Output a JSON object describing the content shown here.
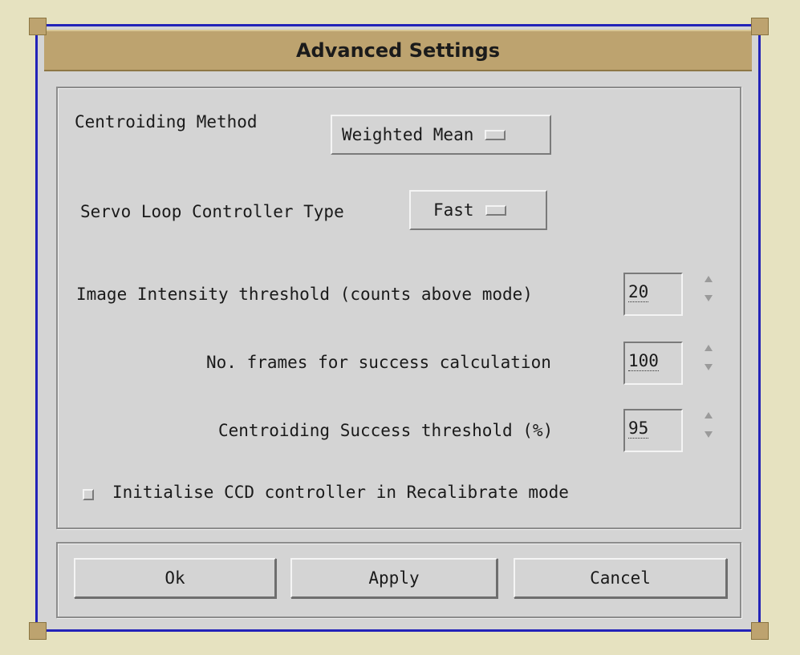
{
  "window": {
    "title": "Advanced Settings"
  },
  "centroiding_method": {
    "label": "Centroiding Method",
    "value": "Weighted Mean"
  },
  "servo_loop": {
    "label": "Servo Loop Controller Type",
    "value": "Fast"
  },
  "intensity_threshold": {
    "label": "Image Intensity threshold (counts above mode)",
    "value": "20"
  },
  "frames_success": {
    "label": "No. frames for success calculation",
    "value": "100"
  },
  "success_threshold": {
    "label": "Centroiding Success threshold (%)",
    "value": "95"
  },
  "init_ccd": {
    "label": "Initialise CCD controller in Recalibrate mode",
    "checked": false
  },
  "buttons": {
    "ok": "Ok",
    "apply": "Apply",
    "cancel": "Cancel"
  }
}
